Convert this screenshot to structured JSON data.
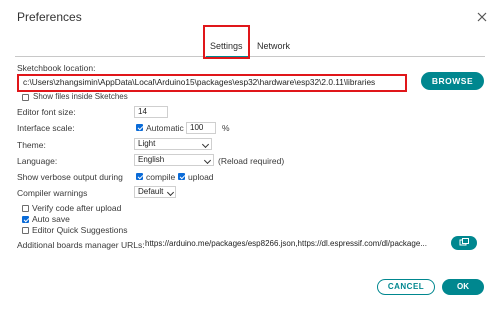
{
  "dialog": {
    "title": "Preferences"
  },
  "tabs": [
    {
      "label": "Settings"
    },
    {
      "label": "Network"
    }
  ],
  "sketchbook": {
    "label": "Sketchbook location:",
    "path": "c:\\Users\\zhangsimin\\AppData\\Local\\Arduino15\\packages\\esp32\\hardware\\esp32\\2.0.11\\libraries",
    "browse_label": "BROWSE",
    "show_files_label": "Show files inside Sketches"
  },
  "editor_font_size": {
    "label": "Editor font size:",
    "value": "14"
  },
  "interface_scale": {
    "label": "Interface scale:",
    "automatic_label": "Automatic",
    "value": "100",
    "unit": "%"
  },
  "theme": {
    "label": "Theme:",
    "value": "Light"
  },
  "language": {
    "label": "Language:",
    "value": "English",
    "note": "(Reload required)"
  },
  "verbose": {
    "label": "Show verbose output during",
    "compile_label": "compile",
    "upload_label": "upload"
  },
  "compiler_warnings": {
    "label": "Compiler warnings",
    "value": "Default"
  },
  "checkboxes": {
    "verify_label": "Verify code after upload",
    "autosave_label": "Auto save",
    "quick_suggestions_label": "Editor Quick Suggestions"
  },
  "boards_manager": {
    "label": "Additional boards manager URLs:",
    "value": "https://arduino.me/packages/esp8266.json,https://dl.espressif.com/dl/package..."
  },
  "footer": {
    "cancel_label": "CANCEL",
    "ok_label": "OK"
  },
  "colors": {
    "accent": "#00878f",
    "highlight": "#e0161a",
    "checkbox": "#0a6bd8"
  }
}
